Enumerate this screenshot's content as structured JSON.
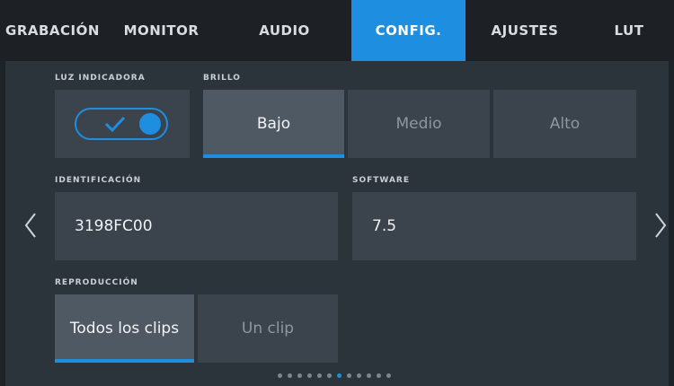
{
  "tabs": [
    {
      "label": "GRABACIÓN",
      "active": false
    },
    {
      "label": "MONITOR",
      "active": false
    },
    {
      "label": "AUDIO",
      "active": false
    },
    {
      "label": "CONFIG.",
      "active": true
    },
    {
      "label": "AJUSTES",
      "active": false
    },
    {
      "label": "LUT",
      "active": false
    }
  ],
  "tally": {
    "label": "LUZ INDICADORA",
    "enabled": true
  },
  "brightness": {
    "label": "BRILLO",
    "options": [
      "Bajo",
      "Medio",
      "Alto"
    ],
    "selected": "Bajo"
  },
  "identification": {
    "label": "IDENTIFICACIÓN",
    "value": "3198FC00"
  },
  "software": {
    "label": "SOFTWARE",
    "value": "7.5"
  },
  "playback": {
    "label": "REPRODUCCIÓN",
    "options": [
      "Todos los clips",
      "Un clip"
    ],
    "selected": "Todos los clips"
  },
  "pagination": {
    "total": 12,
    "current": 7
  },
  "colors": {
    "accent": "#1e8fe0",
    "background": "#2c343b",
    "tile": "#3b444c"
  }
}
